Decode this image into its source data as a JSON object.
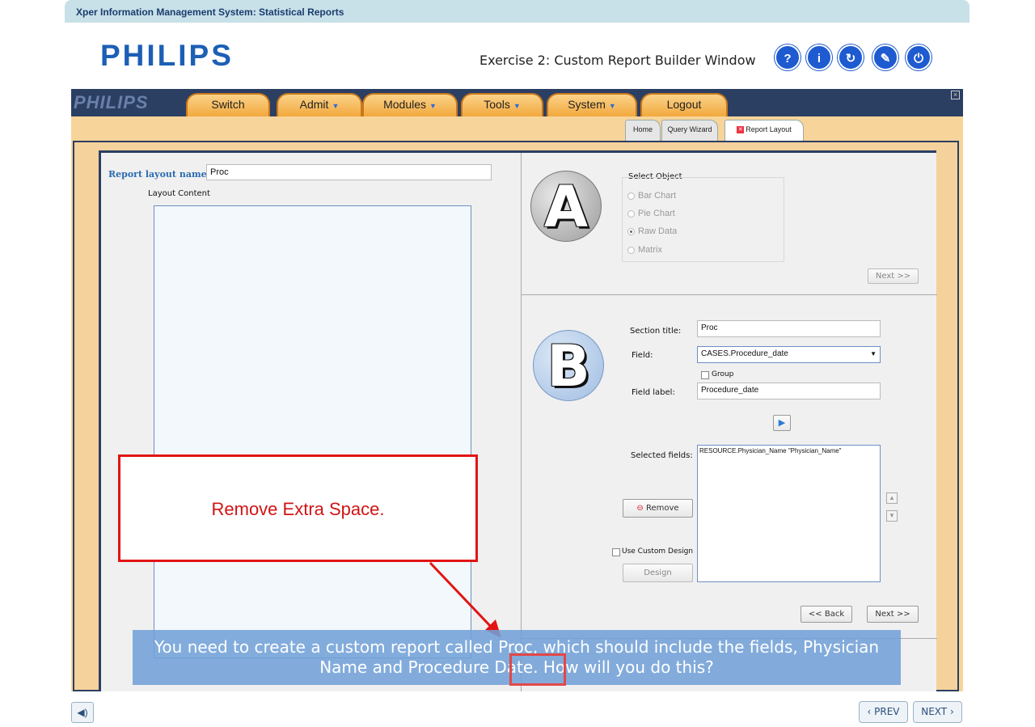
{
  "window": {
    "title": "Xper Information Management System: Statistical Reports"
  },
  "header": {
    "logo": "PHILIPS",
    "exercise_title": "Exercise 2: Custom Report Builder Window",
    "buttons": [
      {
        "label": "?",
        "icon": "help-icon"
      },
      {
        "label": "i",
        "icon": "info-icon"
      },
      {
        "label": "↻",
        "icon": "refresh-icon"
      },
      {
        "label": "✎",
        "icon": "compass-icon"
      },
      {
        "label": "⏻",
        "icon": "power-icon"
      }
    ]
  },
  "menubar": {
    "logo": "PHILIPS",
    "items": [
      {
        "label": "Switch",
        "has_dropdown": false
      },
      {
        "label": "Admit",
        "has_dropdown": true
      },
      {
        "label": "Modules",
        "has_dropdown": true
      },
      {
        "label": "Tools",
        "has_dropdown": true
      },
      {
        "label": "System",
        "has_dropdown": true
      },
      {
        "label": "Logout",
        "has_dropdown": false
      }
    ],
    "close_glyph": "×"
  },
  "subtabs": [
    {
      "label": "Home",
      "active": false
    },
    {
      "label": "Query Wizard",
      "active": false
    },
    {
      "label": "Report Layout",
      "active": true,
      "closable": true
    }
  ],
  "left_pane": {
    "report_layout_label": "Report layout name:",
    "report_layout_value": "Proc",
    "layout_content_label": "Layout Content"
  },
  "section_a": {
    "badge": "A",
    "group_title": "Select Object",
    "options": [
      {
        "label": "Bar Chart",
        "selected": false
      },
      {
        "label": "Pie Chart",
        "selected": false
      },
      {
        "label": "Raw Data",
        "selected": true
      },
      {
        "label": "Matrix",
        "selected": false
      }
    ],
    "next_label": "Next >>"
  },
  "section_b": {
    "badge": "B",
    "section_title_label": "Section title:",
    "section_title_value": "Proc",
    "field_label": "Field:",
    "field_value": "CASES.Procedure_date",
    "group_label": "Group",
    "field_label_label": "Field label:",
    "field_label_value": "Procedure_date",
    "selected_fields_label": "Selected fields:",
    "selected_fields_value": "RESOURCE.Physician_Name \"Physician_Name\"",
    "remove_label": "Remove",
    "use_custom_design_label": "Use Custom Design",
    "design_label": "Design",
    "back_label": "<< Back",
    "next_label": "Next >>"
  },
  "callout": {
    "text": "Remove Extra Space."
  },
  "caption": {
    "text": "You need to create a custom report called Proc, which should include the fields, Physician Name and Procedure Date.  How will you do this?"
  },
  "footer": {
    "audio_icon": "speaker-icon",
    "prev_label": "PREV",
    "next_label": "NEXT"
  },
  "colors": {
    "brand_blue": "#1c5fb5",
    "menubar": "#2b3f63",
    "tab_orange": "#f2a83d",
    "callout_red": "#e21414",
    "caption_blue": "#72a0d7"
  }
}
